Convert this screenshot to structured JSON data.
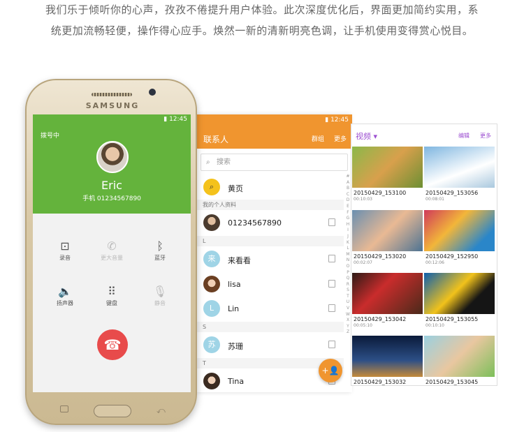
{
  "intro": {
    "line1": "我们乐于倾听你的心声，孜孜不倦提升用户体验。此次深度优化后，界面更加简约实用，系",
    "line2": "统更加流畅轻便，操作得心应手。焕然一新的清新明亮色调，让手机使用变得赏心悦目。"
  },
  "phone": {
    "brand": "SAMSUNG"
  },
  "call": {
    "status_time": "12:45",
    "dialing": "拨号中",
    "name": "Eric",
    "number": "手机  01234567890",
    "controls": [
      {
        "label": "录音",
        "icon": "voicemail-icon"
      },
      {
        "label": "更大音量",
        "icon": "phone-volume-icon"
      },
      {
        "label": "蓝牙",
        "icon": "bluetooth-icon"
      },
      {
        "label": "扬声器",
        "icon": "speaker-icon"
      },
      {
        "label": "键盘",
        "icon": "keypad-icon"
      },
      {
        "label": "静音",
        "icon": "mute-mic-icon"
      }
    ],
    "colors": {
      "header": "#64b33c",
      "end": "#e84b4b"
    }
  },
  "contacts": {
    "status_time": "12:45",
    "title": "联系人",
    "group": "群组",
    "more": "更多",
    "search_placeholder": "搜索",
    "yellow_pages": "黄页",
    "my_profile_header": "我的个人资料",
    "my_number": "01234567890",
    "sections": [
      "L",
      "S",
      "T"
    ],
    "items": [
      {
        "initial": "来",
        "name": "来看看"
      },
      {
        "initial": "",
        "name": "lisa"
      },
      {
        "initial": "L",
        "name": "Lin"
      },
      {
        "initial": "苏",
        "name": "苏珊"
      },
      {
        "initial": "",
        "name": "Tina"
      }
    ],
    "index": "#ABCDEFGHIJKLMNOPQRSTUVWXYZ",
    "colors": {
      "header": "#f0952f"
    }
  },
  "videos": {
    "title": "视频",
    "edit": "编辑",
    "more": "更多",
    "items": [
      {
        "name": "20150429_153100",
        "duration": "00:10:03"
      },
      {
        "name": "20150429_153056",
        "duration": "00:08:01"
      },
      {
        "name": "20150429_153020",
        "duration": "00:02:07"
      },
      {
        "name": "20150429_152950",
        "duration": "00:12:06"
      },
      {
        "name": "20150429_153042",
        "duration": "00:05:10"
      },
      {
        "name": "20150429_153055",
        "duration": "00:10:10"
      },
      {
        "name": "20150429_153032",
        "duration": ""
      },
      {
        "name": "20150429_153045",
        "duration": ""
      }
    ],
    "colors": {
      "accent": "#9c4fd1"
    }
  }
}
